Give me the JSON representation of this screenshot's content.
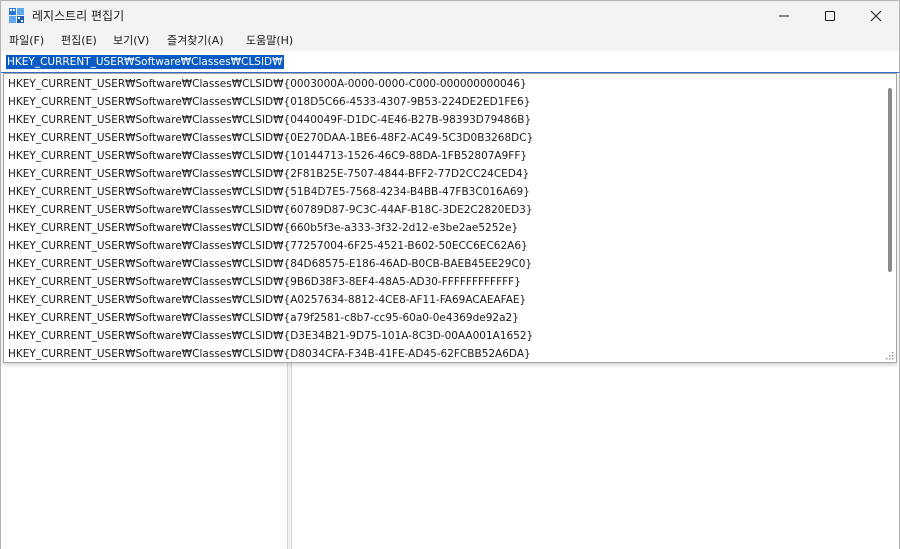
{
  "window": {
    "title": "레지스트리 편집기"
  },
  "icons": {
    "app": "regedit-icon",
    "minimize": "minimize-icon",
    "maximize": "maximize-icon",
    "close": "close-icon",
    "resize_grip": "resize-grip-icon"
  },
  "menu": {
    "items": [
      {
        "label": "파일(F)"
      },
      {
        "label": "편집(E)"
      },
      {
        "label": "보기(V)"
      },
      {
        "label": "즐겨찾기(A)"
      },
      {
        "label": "도움말(H)"
      }
    ]
  },
  "address": {
    "value": "HKEY_CURRENT_USER₩Software₩Classes₩CLSID₩"
  },
  "autocomplete": {
    "items": [
      {
        "label": "HKEY_CURRENT_USER₩Software₩Classes₩CLSID₩{0003000A-0000-0000-C000-000000000046}"
      },
      {
        "label": "HKEY_CURRENT_USER₩Software₩Classes₩CLSID₩{018D5C66-4533-4307-9B53-224DE2ED1FE6}"
      },
      {
        "label": "HKEY_CURRENT_USER₩Software₩Classes₩CLSID₩{0440049F-D1DC-4E46-B27B-98393D79486B}"
      },
      {
        "label": "HKEY_CURRENT_USER₩Software₩Classes₩CLSID₩{0E270DAA-1BE6-48F2-AC49-5C3D0B3268DC}"
      },
      {
        "label": "HKEY_CURRENT_USER₩Software₩Classes₩CLSID₩{10144713-1526-46C9-88DA-1FB52807A9FF}"
      },
      {
        "label": "HKEY_CURRENT_USER₩Software₩Classes₩CLSID₩{2F81B25E-7507-4844-BFF2-77D2CC24CED4}"
      },
      {
        "label": "HKEY_CURRENT_USER₩Software₩Classes₩CLSID₩{51B4D7E5-7568-4234-B4BB-47FB3C016A69}"
      },
      {
        "label": "HKEY_CURRENT_USER₩Software₩Classes₩CLSID₩{60789D87-9C3C-44AF-B18C-3DE2C2820ED3}"
      },
      {
        "label": "HKEY_CURRENT_USER₩Software₩Classes₩CLSID₩{660b5f3e-a333-3f32-2d12-e3be2ae5252e}"
      },
      {
        "label": "HKEY_CURRENT_USER₩Software₩Classes₩CLSID₩{77257004-6F25-4521-B602-50ECC6EC62A6}"
      },
      {
        "label": "HKEY_CURRENT_USER₩Software₩Classes₩CLSID₩{84D68575-E186-46AD-B0CB-BAEB45EE29C0}"
      },
      {
        "label": "HKEY_CURRENT_USER₩Software₩Classes₩CLSID₩{9B6D38F3-8EF4-48A5-AD30-FFFFFFFFFFFF}"
      },
      {
        "label": "HKEY_CURRENT_USER₩Software₩Classes₩CLSID₩{A0257634-8812-4CE8-AF11-FA69ACAEAFAE}"
      },
      {
        "label": "HKEY_CURRENT_USER₩Software₩Classes₩CLSID₩{a79f2581-c8b7-cc95-60a0-0e4369de92a2}"
      },
      {
        "label": "HKEY_CURRENT_USER₩Software₩Classes₩CLSID₩{D3E34B21-9D75-101A-8C3D-00AA001A1652}"
      },
      {
        "label": "HKEY_CURRENT_USER₩Software₩Classes₩CLSID₩{D8034CFA-F34B-41FE-AD45-62FCBB52A6DA}"
      }
    ]
  },
  "colors": {
    "selection": "#0a5bc4",
    "focus_border": "#2f6fd0",
    "chrome": "#f3f3f3"
  }
}
